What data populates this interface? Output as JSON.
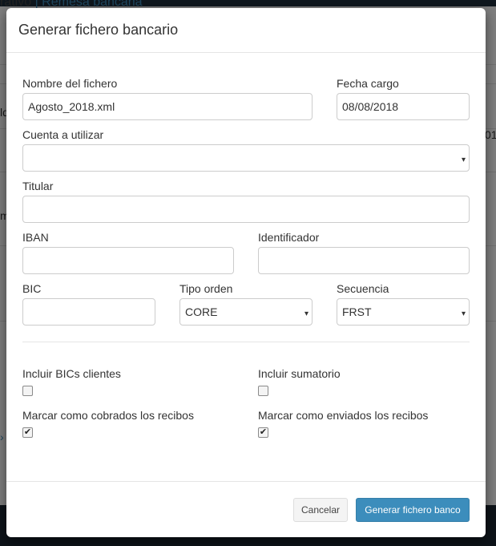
{
  "background": {
    "breadcrumb_prefix": "rativo",
    "breadcrumb_sep": " | ",
    "breadcrumb_link": "Remesa bancaria",
    "frag_1": "ld",
    "frag_2": "01",
    "frag_3": "m",
    "frag_4": "›"
  },
  "modal": {
    "title": "Generar fichero bancario",
    "file_name": {
      "label": "Nombre del fichero",
      "value": "Agosto_2018.xml"
    },
    "charge_date": {
      "label": "Fecha cargo",
      "value": "08/08/2018"
    },
    "account": {
      "label": "Cuenta a utilizar",
      "value": ""
    },
    "holder": {
      "label": "Titular",
      "value": ""
    },
    "iban": {
      "label": "IBAN",
      "value": ""
    },
    "identifier": {
      "label": "Identificador",
      "value": ""
    },
    "bic": {
      "label": "BIC",
      "value": ""
    },
    "order_type": {
      "label": "Tipo orden",
      "value": "CORE"
    },
    "sequence": {
      "label": "Secuencia",
      "value": "FRST"
    },
    "checkboxes": {
      "include_bics": {
        "label": "Incluir BICs clientes",
        "checked": false,
        "mark": ""
      },
      "include_sum": {
        "label": "Incluir sumatorio",
        "checked": false,
        "mark": ""
      },
      "mark_paid": {
        "label": "Marcar como cobrados los recibos",
        "checked": true,
        "mark": "✔"
      },
      "mark_sent": {
        "label": "Marcar como enviados los recibos",
        "checked": true,
        "mark": "✔"
      }
    },
    "buttons": {
      "cancel": "Cancelar",
      "generate": "Generar fichero banco"
    },
    "caret_glyph": "▾"
  },
  "colors": {
    "primary": "#3c8dbc",
    "backdrop": "rgba(0,0,0,0.5)"
  }
}
